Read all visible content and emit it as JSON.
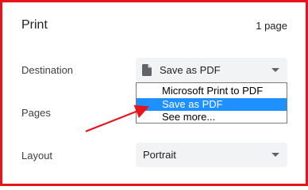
{
  "header": {
    "title": "Print",
    "page_count": "1 page"
  },
  "destination": {
    "label": "Destination",
    "value": "Save as PDF",
    "icon": "document-icon",
    "options": [
      "Microsoft Print to PDF",
      "Save as PDF",
      "See more..."
    ],
    "selected_index": 1
  },
  "pages": {
    "label": "Pages"
  },
  "layout": {
    "label": "Layout",
    "value": "Portrait"
  },
  "colors": {
    "frame": "#e8141b",
    "selected": "#1e90ff",
    "arrow": "#e8141b"
  }
}
